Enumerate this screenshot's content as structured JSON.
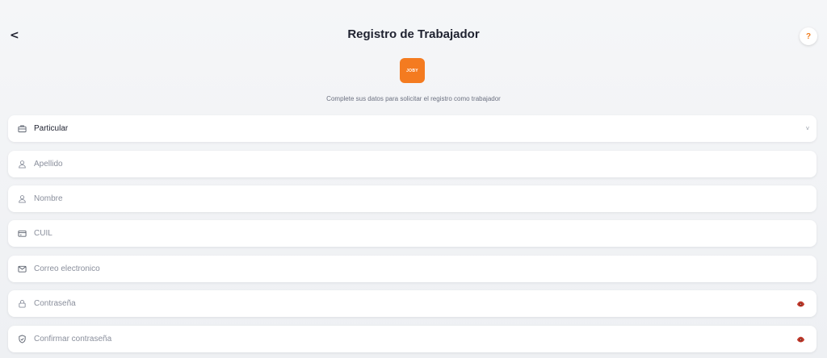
{
  "header": {
    "back_label": "<",
    "title": "Registro de Trabajador",
    "help_label": "?"
  },
  "logo": {
    "text": "JOBY",
    "color": "#f47b20"
  },
  "subtitle": "Complete sus datos para solicitar el registro como trabajador",
  "form": {
    "type_select": {
      "value": "Particular",
      "icon": "briefcase-icon"
    },
    "apellido": {
      "placeholder": "Apellido",
      "icon": "user-icon"
    },
    "nombre": {
      "placeholder": "Nombre",
      "icon": "user-icon"
    },
    "cuil": {
      "placeholder": "CUIL",
      "icon": "id-card-icon"
    },
    "email": {
      "placeholder": "Correo electronico",
      "icon": "mail-icon"
    },
    "password": {
      "placeholder": "Contraseña",
      "icon": "lock-icon",
      "toggle_icon": "eye-icon"
    },
    "confirm_password": {
      "placeholder": "Confirmar contraseña",
      "icon": "shield-icon",
      "toggle_icon": "eye-icon"
    }
  },
  "colors": {
    "accent": "#f47b20",
    "text": "#1f2230",
    "placeholder": "#8a8f9c",
    "eye": "#c0392b"
  }
}
